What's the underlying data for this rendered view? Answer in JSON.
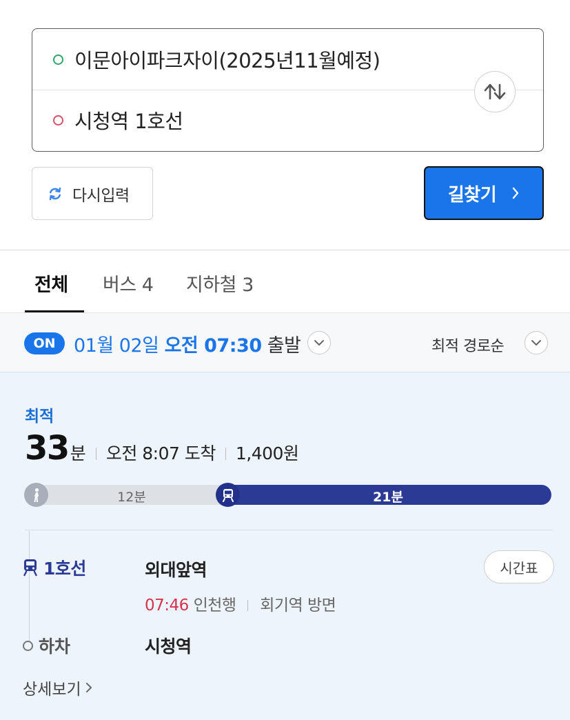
{
  "search": {
    "origin": "이문아이파크자이(2025년11월예정)",
    "destination": "시청역 1호선",
    "reset_label": "다시입력",
    "find_label": "길찾기"
  },
  "tabs": [
    {
      "label": "전체",
      "active": true
    },
    {
      "label": "버스 4",
      "active": false
    },
    {
      "label": "지하철 3",
      "active": false
    }
  ],
  "depart": {
    "badge": "ON",
    "date": "01월 02일",
    "time": "오전 07:30",
    "suffix": "출발",
    "sort_label": "최적 경로순"
  },
  "route": {
    "tag": "최적",
    "duration_num": "33",
    "duration_unit": "분",
    "arrival": "오전 8:07 도착",
    "fare": "1,400원",
    "segments": {
      "walk_label": "12분",
      "subway_label": "21분"
    },
    "line_name": "1호선",
    "board_station": "외대앞역",
    "timetable_label": "시간표",
    "train_time": "07:46",
    "train_direction": "인천행",
    "train_heading": "회기역 방면",
    "alight_label": "하차",
    "alight_station": "시청역",
    "detail_label": "상세보기"
  },
  "colors": {
    "accent": "#1a74ea",
    "subway_line1": "#2a3a95",
    "origin_dot": "#2aa86a",
    "destination_dot": "#d6506a",
    "train_time": "#d6334e"
  },
  "icons": [
    "swap-icon",
    "refresh-icon",
    "chevron-right-icon",
    "chevron-down-icon",
    "walk-icon",
    "subway-icon"
  ]
}
